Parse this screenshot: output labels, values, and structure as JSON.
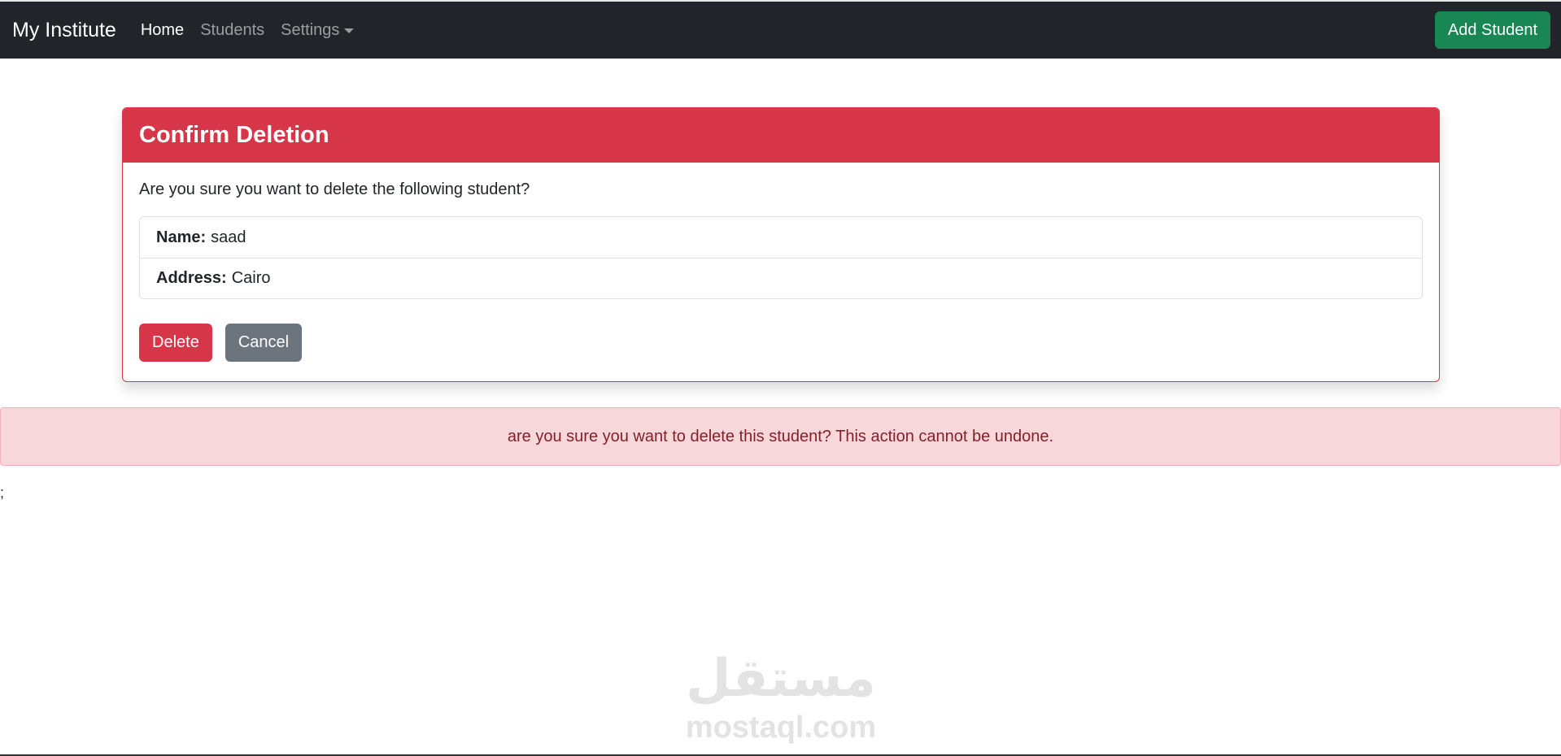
{
  "navbar": {
    "brand": "My Institute",
    "links": [
      {
        "label": "Home",
        "active": true
      },
      {
        "label": "Students",
        "active": false
      },
      {
        "label": "Settings",
        "active": false
      }
    ],
    "add_button": "Add Student"
  },
  "card": {
    "title": "Confirm Deletion",
    "prompt": "Are you sure you want to delete the following student?",
    "fields": [
      {
        "label": "Name:",
        "value": "saad"
      },
      {
        "label": "Address:",
        "value": "Cairo"
      }
    ],
    "delete_label": "Delete",
    "cancel_label": "Cancel"
  },
  "alert": {
    "text": "are you sure you want to delete this student? This action cannot be undone."
  },
  "stray_text": ";",
  "watermark": {
    "logo": "مستقل",
    "url": "mostaql.com"
  },
  "colors": {
    "navbar_bg": "#212529",
    "danger": "#d63647",
    "success": "#198754",
    "secondary": "#6c757d",
    "alert_bg": "#f8d7da",
    "alert_text": "#842029"
  }
}
